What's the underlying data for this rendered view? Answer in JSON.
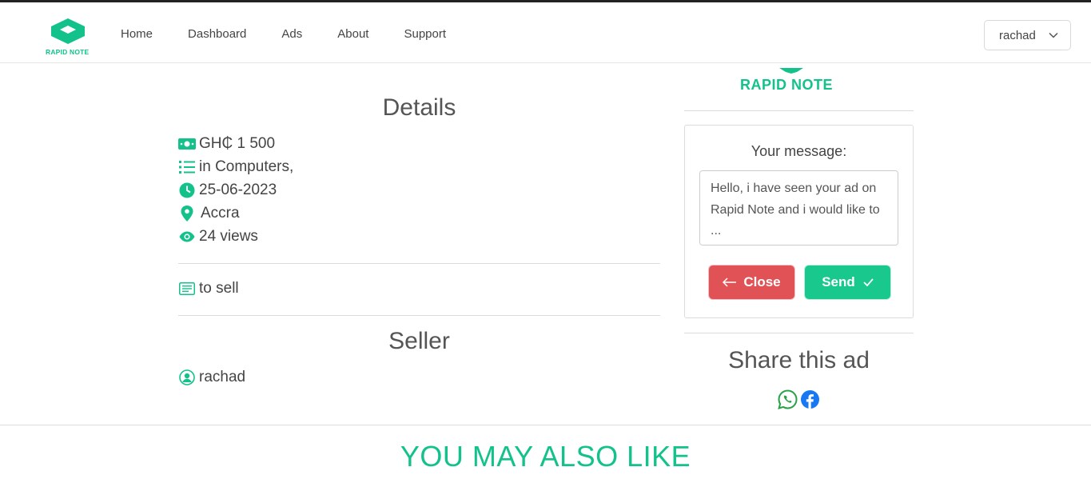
{
  "nav": {
    "logo_text": "RAPID NOTE",
    "links": [
      "Home",
      "Dashboard",
      "Ads",
      "About",
      "Support"
    ],
    "user": "rachad"
  },
  "details": {
    "title": "Details",
    "price": "GH₵ 1 500",
    "category": " in Computers,",
    "date": "25-06-2023",
    "location": "Accra",
    "views": "24 views",
    "description": "to sell"
  },
  "seller": {
    "title": "Seller",
    "name": "rachad"
  },
  "sidebar": {
    "brand": "RAPID NOTE",
    "message_label": "Your message:",
    "message_value": "Hello, i have seen your ad on Rapid Note and i would like to ...",
    "close_label": "Close",
    "send_label": "Send",
    "share_title": "Share this ad"
  },
  "footer": {
    "also_like": "YOU MAY ALSO LIKE"
  },
  "colors": {
    "brand": "#13c28b",
    "close": "#e05256",
    "send": "#19c88d",
    "facebook": "#1877f2",
    "whatsapp": "#25a244"
  }
}
